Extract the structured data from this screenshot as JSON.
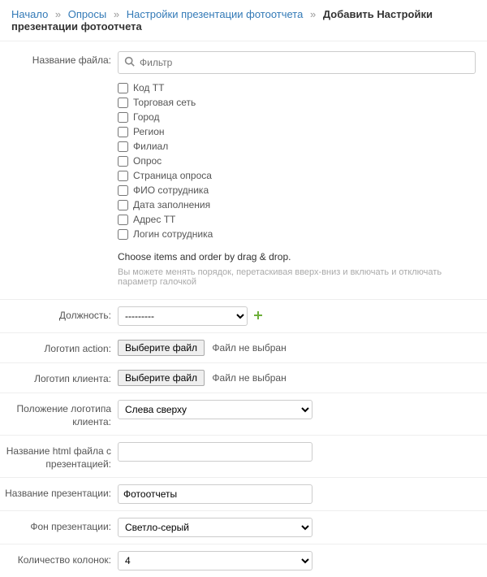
{
  "breadcrumb": {
    "items": [
      "Начало",
      "Опросы",
      "Настройки презентации фотоотчета"
    ],
    "current": "Добавить Настройки презентации фотоотчета"
  },
  "filename": {
    "label": "Название файла:",
    "filter_placeholder": "Фильтр",
    "options": [
      "Код ТТ",
      "Торговая сеть",
      "Город",
      "Регион",
      "Филиал",
      "Опрос",
      "Страница опроса",
      "ФИО сотрудника",
      "Дата заполнения",
      "Адрес ТТ",
      "Логин сотрудника"
    ],
    "drag_note": "Choose items and order by drag & drop.",
    "drag_hint": "Вы можете менять порядок, перетаскивая вверх-вниз и включать и отключать параметр галочкой"
  },
  "position": {
    "label": "Должность:",
    "selected": "---------"
  },
  "action_logo": {
    "label": "Логотип action:",
    "button": "Выберите файл",
    "status": "Файл не выбран"
  },
  "client_logo": {
    "label": "Логотип клиента:",
    "button": "Выберите файл",
    "status": "Файл не выбран"
  },
  "client_logo_pos": {
    "label": "Положение логотипа клиента:",
    "selected": "Слева сверху"
  },
  "html_name": {
    "label": "Название html файла с презентацией:",
    "value": ""
  },
  "pres_name": {
    "label": "Название презентации:",
    "value": "Фотоотчеты"
  },
  "bg": {
    "label": "Фон презентации:",
    "selected": "Светло-серый"
  },
  "cols": {
    "label": "Количество колонок:",
    "selected": "4"
  }
}
